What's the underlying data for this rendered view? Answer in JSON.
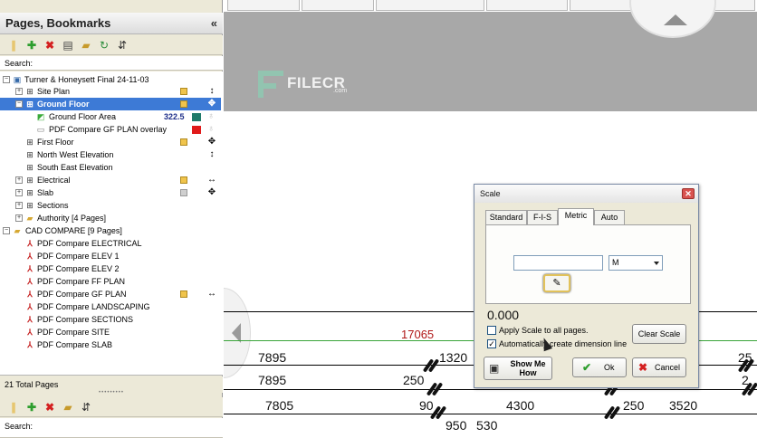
{
  "left_panel": {
    "title": "Pages, Bookmarks",
    "collapse_glyph": "«",
    "search_label": "Search:",
    "status": "21 Total Pages",
    "bottom_search_label": "Search:"
  },
  "tree": {
    "root": "Turner & Honeysett Final 24-11-03",
    "items": {
      "site_plan": "Site Plan",
      "ground_floor": "Ground Floor",
      "ground_floor_area": "Ground Floor Area",
      "ground_floor_area_value": "322.5",
      "pdf_compare_gf_overlay": "PDF Compare GF PLAN overlay",
      "first_floor": "First Floor",
      "north_west_elevation": "North West Elevation",
      "south_east_elevation": "South East Elevation",
      "electrical": "Electrical",
      "slab": "Slab",
      "sections": "Sections",
      "authority": "Authority [4 Pages]",
      "cad_compare": "CAD COMPARE [9 Pages]",
      "pdf_electrical": "PDF Compare ELECTRICAL",
      "pdf_elev1": "PDF Compare ELEV 1",
      "pdf_elev2": "PDF Compare ELEV 2",
      "pdf_ff": "PDF Compare FF PLAN",
      "pdf_gf": "PDF Compare GF PLAN",
      "pdf_landscaping": "PDF Compare LANDSCAPING",
      "pdf_sections": "PDF Compare SECTIONS",
      "pdf_site": "PDF Compare SITE",
      "pdf_slab": "PDF Compare SLAB"
    }
  },
  "watermark": {
    "text": "FILECR",
    "sub": ".com"
  },
  "drawing": {
    "dims": {
      "d17065": "17065",
      "d7895a": "7895",
      "d1320": "1320",
      "d7895b": "7895",
      "d250a": "250",
      "d7805": "7805",
      "d90": "90",
      "d4300": "4300",
      "d250b": "250",
      "d3520": "3520",
      "d950": "950",
      "d530": "530",
      "d25a": "25",
      "d25b": "2"
    }
  },
  "dialog": {
    "title": "Scale",
    "close": "✕",
    "tabs": {
      "standard": "Standard",
      "fis": "F-I-S",
      "metric": "Metric",
      "auto": "Auto"
    },
    "unit": "M",
    "value": "0.000",
    "apply_all": "Apply Scale to all pages.",
    "auto_dim": "Automatically create dimension line",
    "clear_scale": "Clear Scale",
    "show_me_how": "Show Me How",
    "ok": "Ok",
    "cancel": "Cancel"
  },
  "colors": {
    "selection": "#3d7ad6",
    "swatch_teal": "#1f7a6a",
    "swatch_red": "#e01a1a",
    "highlight_yellow": "#f0c44c"
  }
}
